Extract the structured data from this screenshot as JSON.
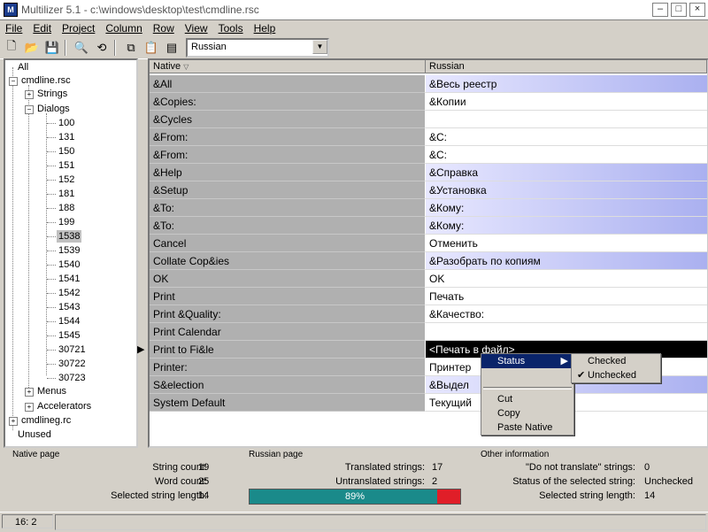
{
  "window": {
    "title": "Multilizer 5.1 - c:\\windows\\desktop\\test\\cmdline.rsc"
  },
  "menu": [
    "File",
    "Edit",
    "Project",
    "Column",
    "Row",
    "View",
    "Tools",
    "Help"
  ],
  "toolbar": {
    "language": "Russian",
    "icons": [
      "new-icon",
      "open-icon",
      "save-icon",
      "find-icon",
      "replace-icon",
      "copy-icon",
      "paste-icon",
      "properties-icon"
    ]
  },
  "tree": {
    "root": "All",
    "file1": "cmdline.rsc",
    "strings": "Strings",
    "dialogs": "Dialogs",
    "dialog_ids": [
      "100",
      "131",
      "150",
      "151",
      "152",
      "181",
      "188",
      "199",
      "1538",
      "1539",
      "1540",
      "1541",
      "1542",
      "1543",
      "1544",
      "1545",
      "30721",
      "30722",
      "30723"
    ],
    "selected": "1538",
    "menus": "Menus",
    "accelerators": "Accelerators",
    "file2": "cmdlineg.rc",
    "unused": "Unused"
  },
  "grid": {
    "headers": {
      "native": "Native",
      "russian": "Russian"
    },
    "rows": [
      {
        "native": "&All",
        "ru": "&Весь реестр",
        "hl": true
      },
      {
        "native": "&Copies:",
        "ru": "&Копии",
        "hl": false
      },
      {
        "native": "&Cycles",
        "ru": "",
        "hl": false
      },
      {
        "native": "&From:",
        "ru": "&C:",
        "hl": false
      },
      {
        "native": "&From:",
        "ru": "&C:",
        "hl": false
      },
      {
        "native": "&Help",
        "ru": "&Справка",
        "hl": true
      },
      {
        "native": "&Setup",
        "ru": "&Установка",
        "hl": true
      },
      {
        "native": "&To:",
        "ru": "&Кому:",
        "hl": true
      },
      {
        "native": "&To:",
        "ru": "&Кому:",
        "hl": true
      },
      {
        "native": "Cancel",
        "ru": "Отменить",
        "hl": false
      },
      {
        "native": "Collate Cop&ies",
        "ru": "&Разобрать по копиям",
        "hl": true
      },
      {
        "native": "OK",
        "ru": "OK",
        "hl": false
      },
      {
        "native": "Print",
        "ru": "Печать",
        "hl": false
      },
      {
        "native": "Print &Quality:",
        "ru": "&Качество:",
        "hl": false
      },
      {
        "native": "Print Calendar",
        "ru": "",
        "hl": false
      },
      {
        "native": "Print to Fi&le",
        "ru": "<Печать в файл>",
        "hl": false,
        "sel": true
      },
      {
        "native": "Printer:",
        "ru": "Принтер",
        "hl": false
      },
      {
        "native": "S&election",
        "ru": "&Выдел",
        "hl": true
      },
      {
        "native": "System Default",
        "ru": "Текущий",
        "hl": false
      }
    ]
  },
  "context_menu": {
    "items": [
      "Status",
      "Cut",
      "Copy",
      "Paste Native"
    ],
    "submenu": [
      "Checked",
      "Unchecked"
    ]
  },
  "stats": {
    "native_title": "Native page",
    "native": [
      {
        "label": "String count:",
        "value": "19"
      },
      {
        "label": "Word count:",
        "value": "25"
      },
      {
        "label": "Selected string length:",
        "value": "14"
      }
    ],
    "russian_title": "Russian page",
    "russian": [
      {
        "label": "Translated strings:",
        "value": "17"
      },
      {
        "label": "Untranslated strings:",
        "value": "2"
      }
    ],
    "progress_percent": 89,
    "progress_label": "89%",
    "other_title": "Other information",
    "other": [
      {
        "label": "\"Do not translate\" strings:",
        "value": "0"
      },
      {
        "label": "Status of the selected string:",
        "value": "Unchecked"
      },
      {
        "label": "Selected string length:",
        "value": "14"
      }
    ]
  },
  "statusbar": {
    "position": "16: 2"
  }
}
